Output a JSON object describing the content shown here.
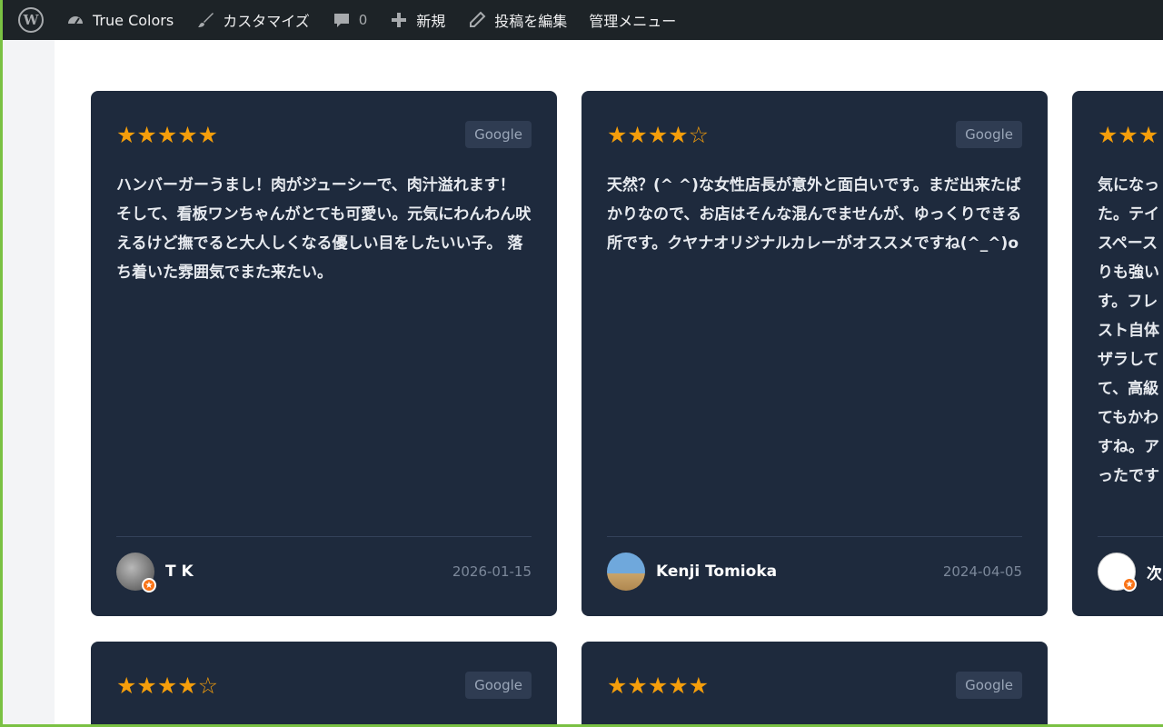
{
  "adminbar": {
    "site_name": "True Colors",
    "customize": "カスタマイズ",
    "comments_count": "0",
    "new": "新規",
    "edit_post": "投稿を編集",
    "admin_menu": "管理メニュー"
  },
  "reviews": [
    {
      "rating": 5,
      "stars": "★★★★★",
      "source": "Google",
      "text": "ハンバーガーうまし！肉がジューシーで、肉汁溢れます！　そして、看板ワンちゃんがとても可愛い。元気にわんわん吠えるけど撫でると大人しくなる優しい目をしたいい子。 落ち着いた雰囲気でまた来たい。",
      "author": "T K",
      "date": "2026-01-15"
    },
    {
      "rating": 4,
      "stars": "★★★★☆",
      "source": "Google",
      "text": "天然？(^ ^)な女性店長が意外と面白いです。まだ出来たばかりなので、お店はそんな混んでませんが、ゆっくりできる所です。クヤナオリジナルカレーがオススメですね(^_^)o",
      "author": "Kenji Tomioka",
      "date": "2024-04-05"
    },
    {
      "rating": 5,
      "stars": "★★★",
      "source": "Google",
      "text": "気になっ\nた。テイ\nスペース\nりも強い\nす。フレ\nスト自体\nザラして\nて、高級\nてもかわ\nすね。ア\nったです",
      "author": "次",
      "date": ""
    },
    {
      "rating": 4,
      "stars": "★★★★☆",
      "source": "Google"
    },
    {
      "rating": 5,
      "stars": "★★★★★",
      "source": "Google"
    }
  ]
}
